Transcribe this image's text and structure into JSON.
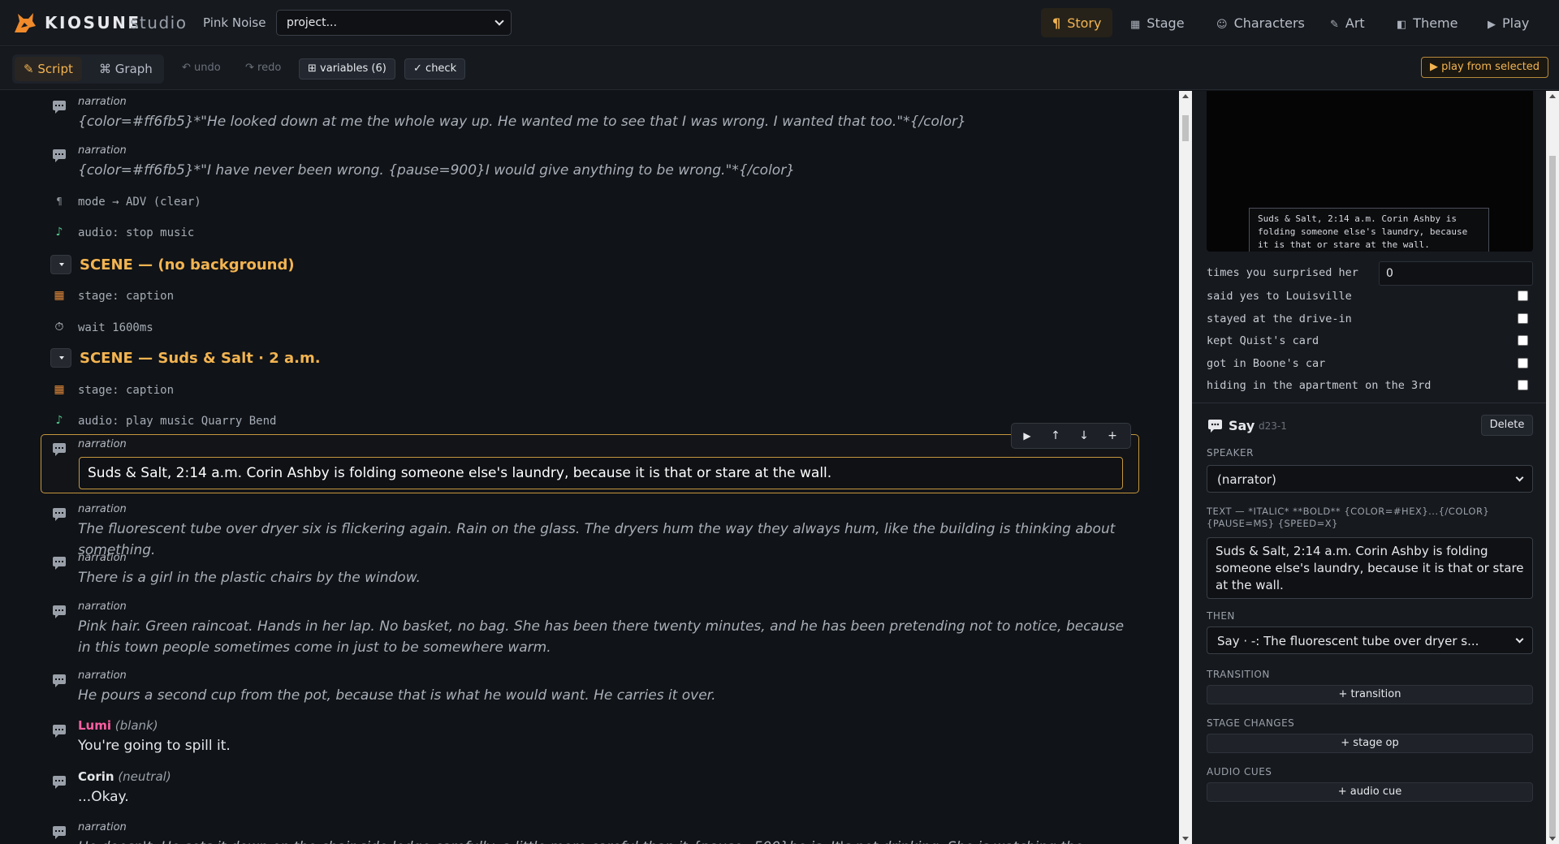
{
  "app": {
    "logo_text": "KIOSUNE",
    "logo_sub": "studio",
    "project_name": "Pink Noise",
    "project_select": "project..."
  },
  "nav": {
    "story": "Story",
    "stage": "Stage",
    "characters": "Characters",
    "art": "Art",
    "theme": "Theme",
    "play": "Play"
  },
  "toolbar": {
    "script": "Script",
    "graph": "Graph",
    "undo": "undo",
    "redo": "redo",
    "variables": "variables (6)",
    "check": "check",
    "play_selected": "play from selected"
  },
  "script": {
    "r1_speaker": "narration",
    "r1_text": "{color=#ff6fb5}*\"He looked down at me the whole way up. He wanted me to see that I was wrong. I wanted that too.\"*{/color}",
    "r2_speaker": "narration",
    "r2_text": "{color=#ff6fb5}*\"I have never been wrong. {pause=900}I would give anything to be wrong.\"*{/color}",
    "r3_cmd": "mode → ADV (clear)",
    "r4_cmd": "audio: stop music",
    "scene1": "SCENE — (no background)",
    "r5_cmd": "stage: caption",
    "r6_cmd": "wait 1600ms",
    "scene2": "SCENE — Suds & Salt · 2 a.m.",
    "r7_cmd": "stage: caption",
    "r8_cmd": "audio: play music Quarry Bend",
    "sel_speaker": "narration",
    "sel_text": "Suds & Salt, 2:14 a.m. Corin Ashby is folding someone else's laundry, because it is that or stare at the wall.",
    "r9_speaker": "narration",
    "r9_text": "The fluorescent tube over dryer six is flickering again. Rain on the glass. The dryers hum the way they always hum, like the building is thinking about something.",
    "r10_speaker": "narration",
    "r10_text": "There is a girl in the plastic chairs by the window.",
    "r11_speaker": "narration",
    "r11_text": "Pink hair. Green raincoat. Hands in her lap. No basket, no bag. She has been there twenty minutes, and he has been pretending not to notice, because in this town people sometimes come in just to be somewhere warm.",
    "r12_speaker": "narration",
    "r12_text": "He pours a second cup from the pot, because that is what he would want. He carries it over.",
    "r13_speaker": "Lumi",
    "r13_emotion": "(blank)",
    "r13_text": "You're going to spill it.",
    "r14_speaker": "Corin",
    "r14_emotion": "(neutral)",
    "r14_text": "...Okay.",
    "r15_speaker": "narration",
    "r15_text": "He doesn't. He sets it down on the chair-side ledge carefully, a little more careful than it {pause=500}he is. It's not drinking. She is watching the..."
  },
  "preview": {
    "caption": "Suds & Salt, 2:14 a.m. Corin Ashby is folding someone else's laundry, because it is that or stare at the wall."
  },
  "variables": [
    {
      "label": "times you surprised her",
      "value": "0"
    },
    {
      "label": "said yes to Louisville"
    },
    {
      "label": "stayed at the drive-in"
    },
    {
      "label": "kept Quist's card"
    },
    {
      "label": "got in Boone's car"
    },
    {
      "label": "hiding in the apartment on the 3rd"
    }
  ],
  "inspector": {
    "title": "Say",
    "id": "d23-1",
    "delete": "Delete",
    "speaker_label": "SPEAKER",
    "speaker_value": "(narrator)",
    "text_label": "TEXT — *ITALIC* **BOLD** {COLOR=#HEX}...{/COLOR} {PAUSE=MS} {SPEED=X}",
    "text_value": "Suds & Salt, 2:14 a.m. Corin Ashby is folding someone else's laundry, because it is that or stare at the wall.",
    "then_label": "THEN",
    "then_value": "Say · -: The fluorescent tube over dryer s...",
    "transition_label": "TRANSITION",
    "transition_btn": "+ transition",
    "stage_label": "STAGE CHANGES",
    "stage_btn": "+ stage op",
    "audio_label": "AUDIO CUES",
    "audio_btn": "+ audio cue"
  },
  "colors": {
    "accent": "#f3b451",
    "lumi": "#ff5fa2",
    "background": "#101317"
  }
}
